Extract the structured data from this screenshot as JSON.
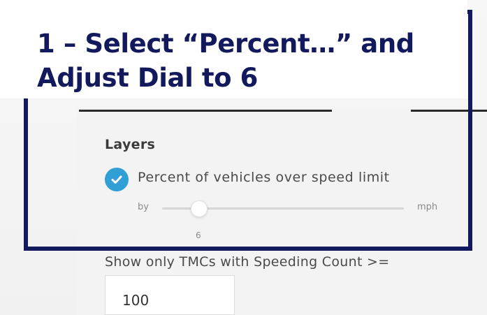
{
  "callout": {
    "line1": "1 – Select “Percent…” and",
    "line2": "Adjust Dial to 6",
    "color": "#13195d"
  },
  "layers": {
    "title": "Layers",
    "option_label": "Percent of vehicles over speed limit",
    "option_checked": true,
    "checkbox_color": "#2f9fd6",
    "check_icon": "check-icon"
  },
  "slider": {
    "prefix": "by",
    "suffix": "mph",
    "value_label": "6",
    "value": 6
  },
  "filter": {
    "label": "Show only TMCs with Speeding Count >=",
    "value": "100"
  }
}
